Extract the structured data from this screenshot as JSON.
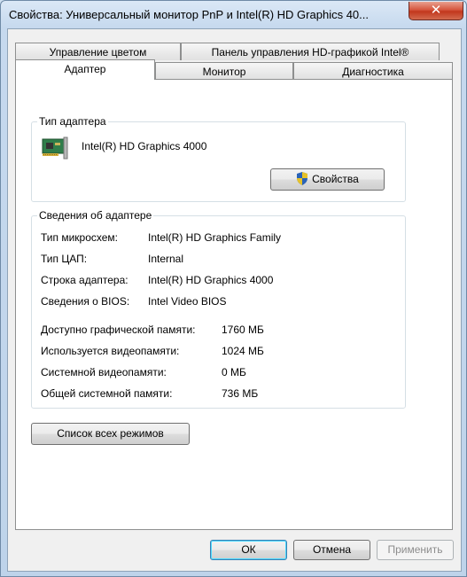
{
  "window": {
    "title": "Свойства: Универсальный монитор PnP и Intel(R) HD Graphics 40...",
    "close_glyph": "✕"
  },
  "tabs": {
    "row1": [
      "Управление цветом",
      "Панель управления HD-графикой Intel®"
    ],
    "row2": [
      "Адаптер",
      "Монитор",
      "Диагностика"
    ],
    "active": "Адаптер"
  },
  "adapter_type": {
    "group_title": "Тип адаптера",
    "name": "Intel(R) HD Graphics 4000",
    "properties_button": "Свойства",
    "icon": "video-card-icon"
  },
  "adapter_info": {
    "group_title": "Сведения об адаптере",
    "rows": [
      {
        "label": "Тип микросхем:",
        "value": "Intel(R) HD Graphics Family"
      },
      {
        "label": "Тип ЦАП:",
        "value": "Internal"
      },
      {
        "label": "Строка адаптера:",
        "value": "Intel(R) HD Graphics 4000"
      },
      {
        "label": "Сведения о BIOS:",
        "value": "Intel Video BIOS"
      }
    ],
    "memory": [
      {
        "label": "Доступно графической памяти:",
        "value": "1760 МБ"
      },
      {
        "label": "Используется видеопамяти:",
        "value": "1024 МБ"
      },
      {
        "label": "Системной видеопамяти:",
        "value": "0 МБ"
      },
      {
        "label": "Общей системной памяти:",
        "value": "736 МБ"
      }
    ]
  },
  "list_modes_button": "Список всех режимов",
  "footer": {
    "ok": "ОК",
    "cancel": "Отмена",
    "apply": "Применить"
  }
}
